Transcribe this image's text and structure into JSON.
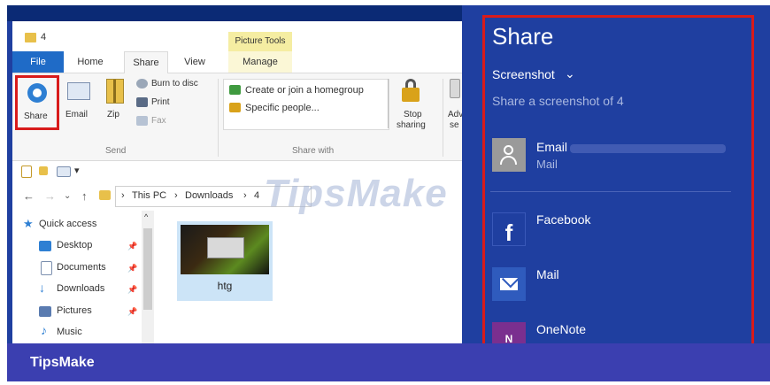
{
  "window": {
    "title": "4",
    "context_tab_group": "Picture Tools"
  },
  "ribbon": {
    "tabs": [
      "File",
      "Home",
      "Share",
      "View",
      "Manage"
    ],
    "send_group": {
      "label": "Send",
      "share": "Share",
      "email": "Email",
      "zip": "Zip",
      "burn": "Burn to disc",
      "print": "Print",
      "fax": "Fax"
    },
    "share_with_group": {
      "label": "Share with",
      "homegroup": "Create or join a homegroup",
      "specific": "Specific people...",
      "stop_sharing_1": "Stop",
      "stop_sharing_2": "sharing",
      "advanced_1": "Adv",
      "advanced_2": "se"
    }
  },
  "address": {
    "crumbs": [
      "This PC",
      "Downloads",
      "4"
    ],
    "separator": "›"
  },
  "nav_pane": {
    "items": [
      {
        "label": "Quick access",
        "icon": "star-icon"
      },
      {
        "label": "Desktop",
        "icon": "desktop-icon",
        "pinned": true
      },
      {
        "label": "Documents",
        "icon": "documents-icon",
        "pinned": true
      },
      {
        "label": "Downloads",
        "icon": "downloads-icon",
        "pinned": true
      },
      {
        "label": "Pictures",
        "icon": "pictures-icon",
        "pinned": true
      },
      {
        "label": "Music",
        "icon": "music-icon",
        "pinned": false
      }
    ]
  },
  "files": [
    {
      "name": "htg"
    }
  ],
  "share_pane": {
    "title": "Share",
    "dropdown": "Screenshot",
    "subtitle": "Share a screenshot of 4",
    "targets": [
      {
        "label": "Email",
        "sublabel": "Mail",
        "icon": "person-icon"
      },
      {
        "label": "Facebook",
        "icon": "facebook-icon"
      },
      {
        "label": "Mail",
        "icon": "mail-icon"
      },
      {
        "label": "OneNote",
        "icon": "onenote-icon"
      }
    ]
  },
  "watermark": "TipsMake",
  "footer": {
    "brand": "TipsMake"
  },
  "colors": {
    "accent": "#1f3fa0",
    "highlight": "#d81b1b",
    "file_tab": "#1f6bc7",
    "footer": "#3b3fb0"
  }
}
